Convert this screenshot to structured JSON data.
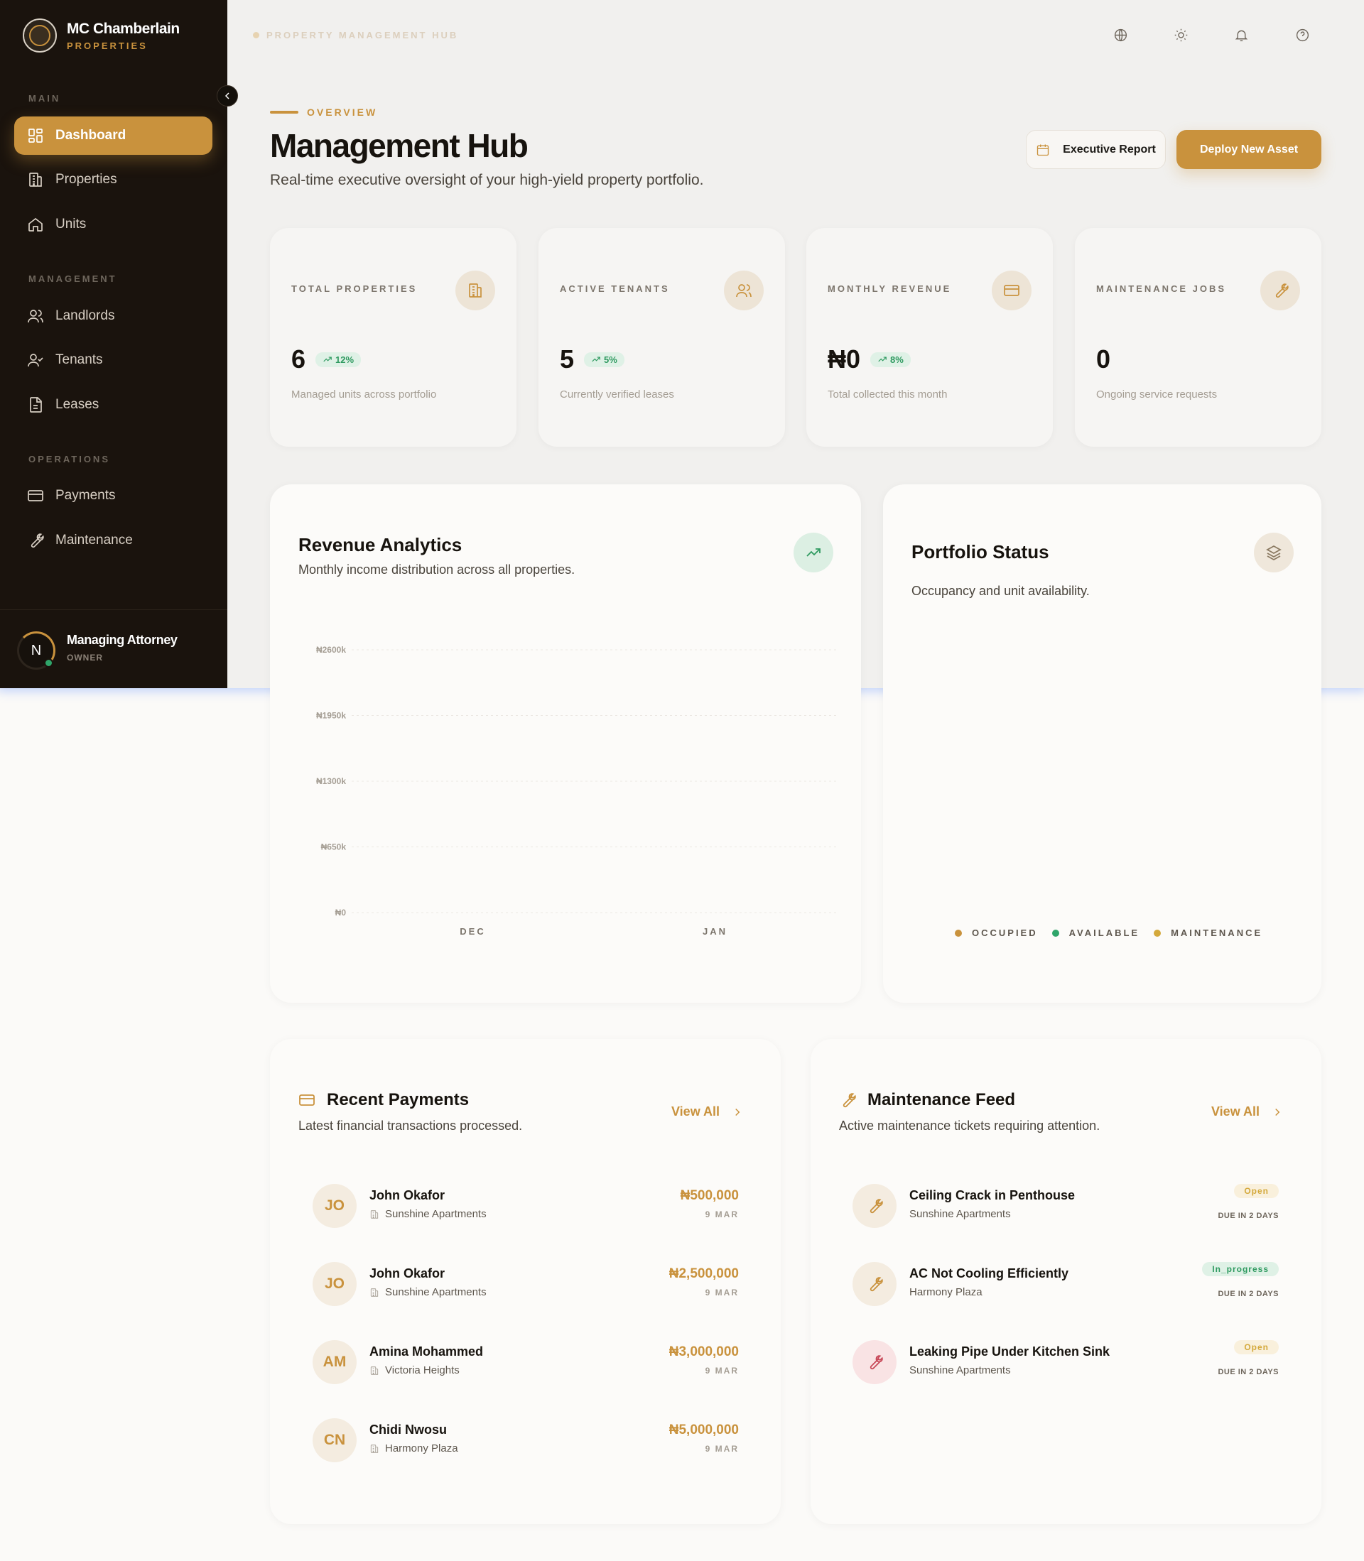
{
  "colors": {
    "accent": "#c9923d",
    "sidebar_bg": "#1a130d",
    "success": "#2fa56a",
    "danger": "#c84a5a"
  },
  "brand": {
    "name": "MC Chamberlain",
    "sub": "PROPERTIES"
  },
  "sidebar": {
    "sections": {
      "main": "MAIN",
      "management": "MANAGEMENT",
      "operations": "OPERATIONS"
    },
    "items": [
      {
        "label": "Dashboard",
        "icon": "dashboard-icon",
        "active": true
      },
      {
        "label": "Properties",
        "icon": "building-icon"
      },
      {
        "label": "Units",
        "icon": "home-icon"
      },
      {
        "label": "Landlords",
        "icon": "users-icon"
      },
      {
        "label": "Tenants",
        "icon": "user-check-icon"
      },
      {
        "label": "Leases",
        "icon": "document-icon"
      },
      {
        "label": "Payments",
        "icon": "card-icon"
      },
      {
        "label": "Maintenance",
        "icon": "wrench-icon"
      }
    ],
    "user": {
      "initial": "N",
      "name": "Managing Attorney",
      "role": "OWNER"
    }
  },
  "topbar": {
    "breadcrumb": "PROPERTY MANAGEMENT HUB",
    "icons": [
      "globe-icon",
      "sun-icon",
      "bell-icon",
      "help-icon"
    ]
  },
  "header": {
    "eyebrow": "OVERVIEW",
    "title": "Management Hub",
    "subtitle": "Real-time executive oversight of your high-yield property portfolio.",
    "report_button": "Executive Report",
    "deploy_button": "Deploy New Asset"
  },
  "stats": [
    {
      "label": "TOTAL PROPERTIES",
      "value": "6",
      "trend": "12%",
      "desc": "Managed units across portfolio",
      "icon": "building-icon"
    },
    {
      "label": "ACTIVE TENANTS",
      "value": "5",
      "trend": "5%",
      "desc": "Currently verified leases",
      "icon": "users-icon"
    },
    {
      "label": "MONTHLY REVENUE",
      "value": "₦0",
      "trend": "8%",
      "desc": "Total collected this month",
      "icon": "card-icon"
    },
    {
      "label": "MAINTENANCE JOBS",
      "value": "0",
      "trend": "",
      "desc": "Ongoing service requests",
      "icon": "wrench-icon"
    }
  ],
  "revenue": {
    "title": "Revenue Analytics",
    "subtitle": "Monthly income distribution across all properties."
  },
  "chart_data": {
    "type": "bar",
    "categories": [
      "DEC",
      "JAN"
    ],
    "values": [
      0,
      0
    ],
    "yticks": [
      "₦0",
      "₦650k",
      "₦1300k",
      "₦1950k",
      "₦2600k"
    ],
    "ylim": [
      0,
      2600
    ],
    "grid": true
  },
  "portfolio": {
    "title": "Portfolio Status",
    "subtitle": "Occupancy and unit availability.",
    "legend": [
      {
        "label": "OCCUPIED",
        "color": "#c9923d"
      },
      {
        "label": "AVAILABLE",
        "color": "#2fa56a"
      },
      {
        "label": "MAINTENANCE",
        "color": "#d4a93c"
      }
    ]
  },
  "payments": {
    "title": "Recent Payments",
    "subtitle": "Latest financial transactions processed.",
    "view_all": "View All",
    "rows": [
      {
        "initials": "JO",
        "name": "John Okafor",
        "location": "Sunshine Apartments",
        "amount": "₦500,000",
        "date": "9 MAR"
      },
      {
        "initials": "JO",
        "name": "John Okafor",
        "location": "Sunshine Apartments",
        "amount": "₦2,500,000",
        "date": "9 MAR"
      },
      {
        "initials": "AM",
        "name": "Amina Mohammed",
        "location": "Victoria Heights",
        "amount": "₦3,000,000",
        "date": "9 MAR"
      },
      {
        "initials": "CN",
        "name": "Chidi Nwosu",
        "location": "Harmony Plaza",
        "amount": "₦5,000,000",
        "date": "9 MAR"
      }
    ]
  },
  "maintenance": {
    "title": "Maintenance Feed",
    "subtitle": "Active maintenance tickets requiring attention.",
    "view_all": "View All",
    "rows": [
      {
        "title": "Ceiling Crack in Penthouse",
        "location": "Sunshine Apartments",
        "status": "Open",
        "due": "DUE IN 2 DAYS"
      },
      {
        "title": "AC Not Cooling Efficiently",
        "location": "Harmony Plaza",
        "status": "In_progress",
        "due": "DUE IN 2 DAYS"
      },
      {
        "title": "Leaking Pipe Under Kitchen Sink",
        "location": "Sunshine Apartments",
        "status": "Open",
        "due": "DUE IN 2 DAYS"
      }
    ]
  }
}
